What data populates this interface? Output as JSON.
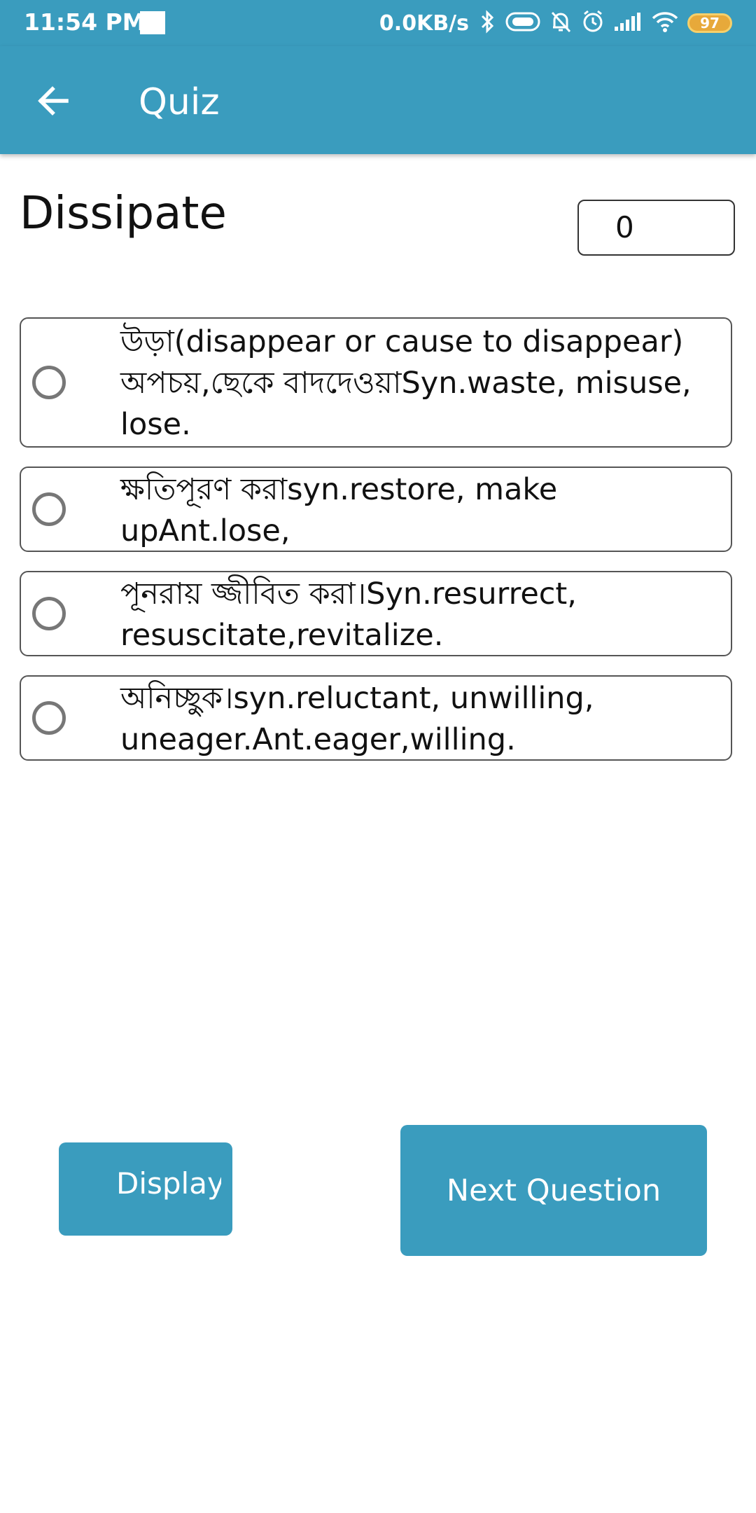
{
  "status_bar": {
    "time": "11:54 PM",
    "network_speed": "0.0KB/s",
    "battery": "97",
    "icons": [
      "notification-square-icon",
      "bluetooth-icon",
      "pill-icon",
      "bell-off-icon",
      "alarm-icon",
      "signal-icon",
      "wifi-icon",
      "battery-icon"
    ]
  },
  "app_bar": {
    "title": "Quiz",
    "back_icon": "arrow-left-icon"
  },
  "question": {
    "word": "Dissipate",
    "score": "0"
  },
  "options": [
    {
      "text": "উড়া(disappear or cause to disappear) অপচয়,ছেকে বাদদেওয়াSyn.waste, misuse, lose."
    },
    {
      "text": "ক্ষতিপূরণ করাsyn.restore, make upAnt.lose,"
    },
    {
      "text": "পূনরায় জ্জীবিত করা।Syn.resurrect, resuscitate,revitalize."
    },
    {
      "text": "অনিচ্ছুক।syn.reluctant, unwilling, uneager.Ant.eager,willing."
    }
  ],
  "buttons": {
    "display": "Display",
    "next": "Next Question"
  },
  "colors": {
    "primary": "#3a9cbe",
    "battery": "#e7a93a"
  }
}
